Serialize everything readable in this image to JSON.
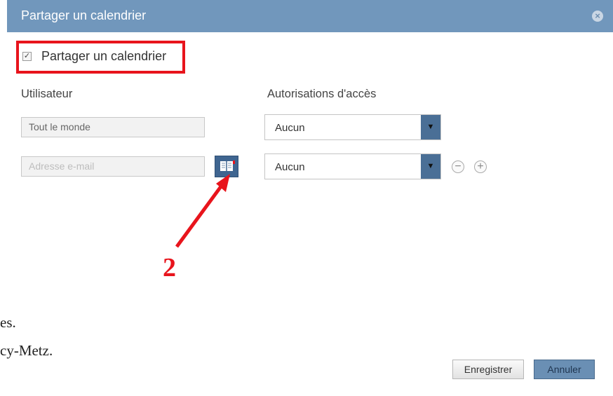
{
  "dialog": {
    "title": "Partager un calendrier",
    "close_icon": "close-icon"
  },
  "share": {
    "checkbox_checked": true,
    "checkbox_label": "Partager un calendrier"
  },
  "columns": {
    "user_header": "Utilisateur",
    "access_header": "Autorisations d'accès"
  },
  "rows": [
    {
      "user_value": "Tout le monde",
      "access_value": "Aucun"
    },
    {
      "user_placeholder": "Adresse e-mail",
      "access_value": "Aucun"
    }
  ],
  "annotation": {
    "number": "2",
    "color": "#e8141c"
  },
  "background_text": {
    "line1": "es.",
    "line2": "cy-Metz."
  },
  "buttons": {
    "save": "Enregistrer",
    "cancel": "Annuler"
  },
  "colors": {
    "titlebar": "#7197bc",
    "accent": "#4a6f96",
    "highlight": "#e8141c"
  }
}
